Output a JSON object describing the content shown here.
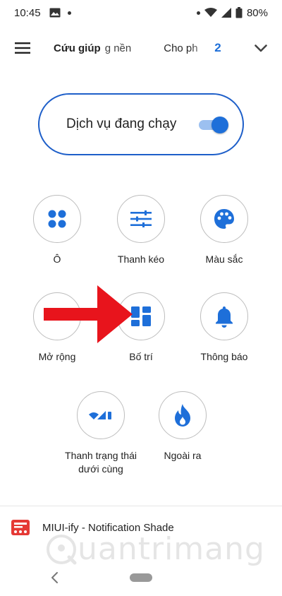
{
  "status_bar": {
    "time": "10:45",
    "battery": "80%"
  },
  "top_bar": {
    "tabs": [
      "Cứu giúp",
      "g nền",
      "Cho ph"
    ],
    "count": "2"
  },
  "service": {
    "label": "Dịch vụ đang chạy",
    "enabled": true
  },
  "grid": {
    "items": [
      {
        "label": "Ô",
        "icon": "tiles-icon"
      },
      {
        "label": "Thanh kéo",
        "icon": "sliders-icon"
      },
      {
        "label": "Màu sắc",
        "icon": "palette-icon"
      },
      {
        "label": "Mở rộng",
        "icon": "expand-icon"
      },
      {
        "label": "Bố trí",
        "icon": "layout-icon"
      },
      {
        "label": "Thông báo",
        "icon": "bell-icon"
      },
      {
        "label": "Thanh trạng thái dưới cùng",
        "icon": "status-bar-icon"
      },
      {
        "label": "Ngoài ra",
        "icon": "flame-icon"
      }
    ]
  },
  "notification": {
    "label": "MIUI-ify - Notification Shade"
  },
  "watermark": {
    "text": "uantrimang"
  },
  "colors": {
    "accent": "#1e6fd9",
    "pill_border": "#1e5fc9",
    "arrow": "#e8141c"
  }
}
